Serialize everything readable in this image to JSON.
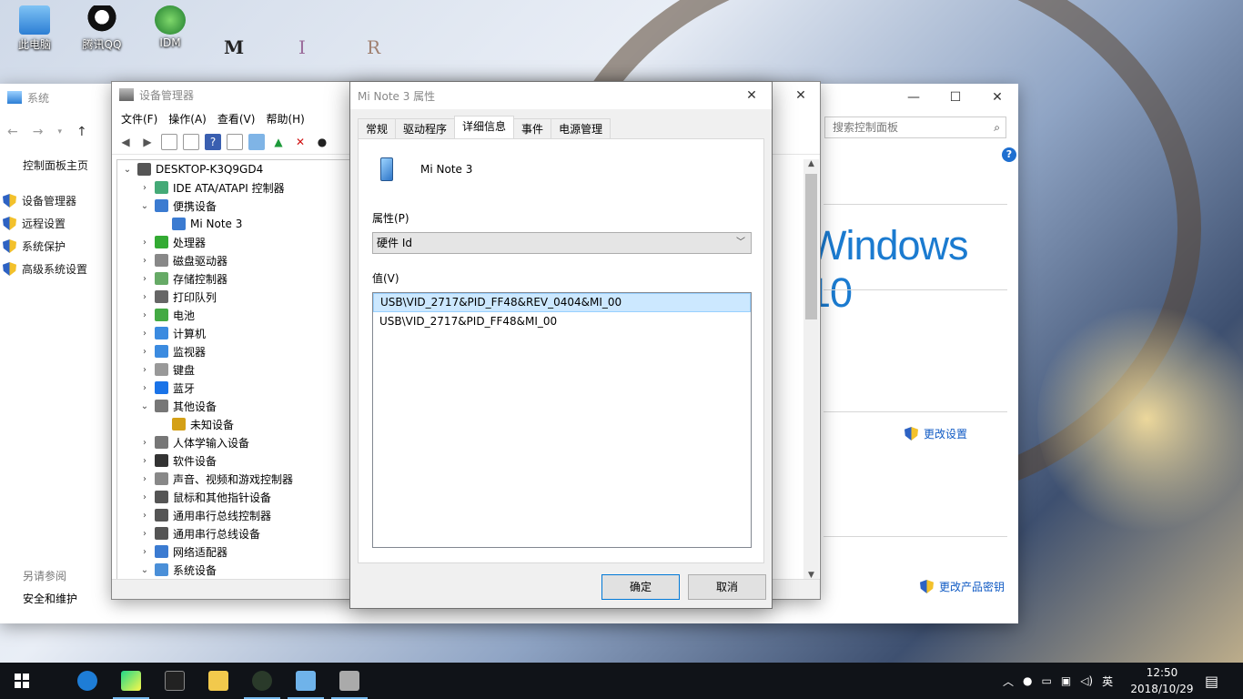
{
  "desktop": {
    "icons": [
      "此电脑",
      "腾讯QQ",
      "IDM"
    ],
    "letters": [
      "M",
      "I",
      "R"
    ]
  },
  "system_window": {
    "title": "系统",
    "search_placeholder": "搜索控制面板",
    "side_home": "控制面板主页",
    "side_links": [
      "设备管理器",
      "远程设置",
      "系统保护",
      "高级系统设置"
    ],
    "see_also": "另请参阅",
    "see_also_link": "安全和维护",
    "brand": "Windows 10",
    "change_settings": "更改设置",
    "change_key": "更改产品密钥",
    "help": "?"
  },
  "device_manager": {
    "title": "设备管理器",
    "menu": [
      "文件(F)",
      "操作(A)",
      "查看(V)",
      "帮助(H)"
    ],
    "tree": [
      {
        "label": "DESKTOP-K3Q9GD4",
        "level": 0,
        "expanded": true
      },
      {
        "label": "IDE ATA/ATAPI 控制器",
        "level": 1,
        "expanded": false
      },
      {
        "label": "便携设备",
        "level": 1,
        "expanded": true
      },
      {
        "label": "Mi Note 3",
        "level": 2,
        "expanded": null
      },
      {
        "label": "处理器",
        "level": 1,
        "expanded": false
      },
      {
        "label": "磁盘驱动器",
        "level": 1,
        "expanded": false
      },
      {
        "label": "存储控制器",
        "level": 1,
        "expanded": false
      },
      {
        "label": "打印队列",
        "level": 1,
        "expanded": false
      },
      {
        "label": "电池",
        "level": 1,
        "expanded": false
      },
      {
        "label": "计算机",
        "level": 1,
        "expanded": false
      },
      {
        "label": "监视器",
        "level": 1,
        "expanded": false
      },
      {
        "label": "键盘",
        "level": 1,
        "expanded": false
      },
      {
        "label": "蓝牙",
        "level": 1,
        "expanded": false
      },
      {
        "label": "其他设备",
        "level": 1,
        "expanded": true
      },
      {
        "label": "未知设备",
        "level": 2,
        "expanded": null
      },
      {
        "label": "人体学输入设备",
        "level": 1,
        "expanded": false
      },
      {
        "label": "软件设备",
        "level": 1,
        "expanded": false
      },
      {
        "label": "声音、视频和游戏控制器",
        "level": 1,
        "expanded": false
      },
      {
        "label": "鼠标和其他指针设备",
        "level": 1,
        "expanded": false
      },
      {
        "label": "通用串行总线控制器",
        "level": 1,
        "expanded": false
      },
      {
        "label": "通用串行总线设备",
        "level": 1,
        "expanded": false
      },
      {
        "label": "网络适配器",
        "level": 1,
        "expanded": false
      },
      {
        "label": "系统设备",
        "level": 1,
        "expanded": true
      }
    ]
  },
  "properties": {
    "title": "Mi Note 3 属性",
    "tabs": [
      "常规",
      "驱动程序",
      "详细信息",
      "事件",
      "电源管理"
    ],
    "active_tab": 2,
    "device_name": "Mi Note 3",
    "property_label": "属性(P)",
    "property_value": "硬件 Id",
    "value_label": "值(V)",
    "values": [
      "USB\\VID_2717&PID_FF48&REV_0404&MI_00",
      "USB\\VID_2717&PID_FF48&MI_00"
    ],
    "ok": "确定",
    "cancel": "取消"
  },
  "taskbar": {
    "ime": "英",
    "time": "12:50",
    "date": "2018/10/29",
    "accent": "#76b9ed"
  }
}
